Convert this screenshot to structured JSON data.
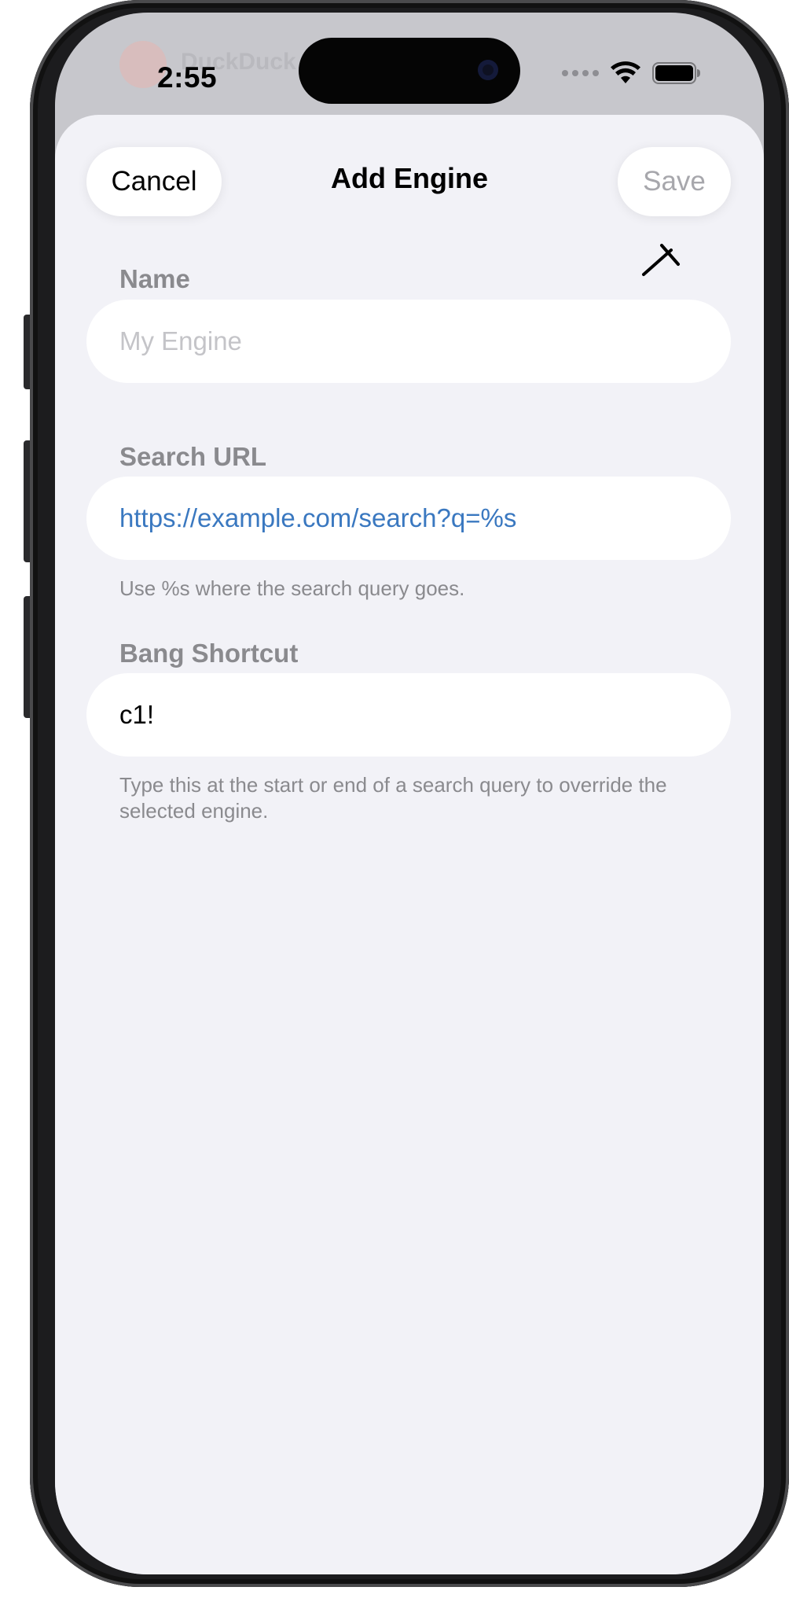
{
  "status_bar": {
    "time": "2:55"
  },
  "background_app": {
    "name_hint": "DuckDuck"
  },
  "sheet": {
    "title": "Add Engine",
    "cancel_label": "Cancel",
    "save_label": "Save"
  },
  "form": {
    "name": {
      "label": "Name",
      "placeholder": "My Engine",
      "value": ""
    },
    "search_url": {
      "label": "Search URL",
      "value": "https://example.com/search?q=%s",
      "help": "Use %s where the search query goes."
    },
    "bang_shortcut": {
      "label": "Bang Shortcut",
      "value": "c1!",
      "help": "Type this at the start or end of a search query to override the selected engine."
    }
  },
  "colors": {
    "sheet_background": "#f2f2f7",
    "field_background": "#ffffff",
    "label_gray": "#8a8a8e",
    "link_blue": "#3a78c0",
    "disabled_text": "#a7a7ac"
  },
  "icons": {
    "wifi": "wifi-icon",
    "battery": "battery-icon",
    "cursor": "text-cursor-icon"
  }
}
